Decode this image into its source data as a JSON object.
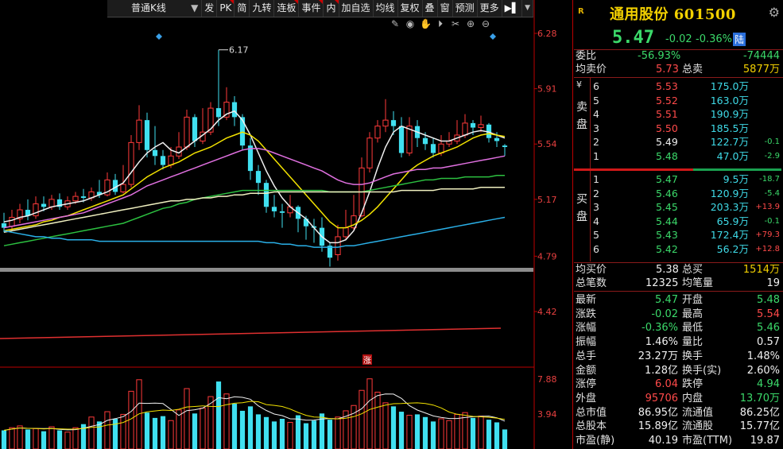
{
  "toolbar": {
    "chart_type": "普通K线",
    "items": [
      "发",
      "PK",
      "简",
      "九转",
      "连板",
      "事件",
      "内",
      "加自选",
      "均线",
      "复权",
      "叠",
      "窗",
      "预测",
      "更多"
    ]
  },
  "price_axis": [
    "6.28",
    "5.91",
    "5.54",
    "5.17",
    "4.79",
    "4.42"
  ],
  "volume_axis": [
    "7.88",
    "3.94"
  ],
  "high_marker": "6.17",
  "limit_marker": "涨",
  "chart_data": {
    "type": "candlestick",
    "title": "",
    "ylim": [
      4.42,
      6.28
    ],
    "candles": [
      {
        "o": 5.01,
        "c": 4.98,
        "h": 5.08,
        "l": 4.95
      },
      {
        "o": 4.99,
        "c": 5.05,
        "h": 5.1,
        "l": 4.96
      },
      {
        "o": 5.04,
        "c": 5.1,
        "h": 5.14,
        "l": 5.01
      },
      {
        "o": 5.1,
        "c": 5.06,
        "h": 5.17,
        "l": 5.03
      },
      {
        "o": 5.06,
        "c": 5.14,
        "h": 5.19,
        "l": 5.04
      },
      {
        "o": 5.14,
        "c": 5.12,
        "h": 5.19,
        "l": 5.09
      },
      {
        "o": 5.12,
        "c": 5.17,
        "h": 5.2,
        "l": 5.1
      },
      {
        "o": 5.17,
        "c": 5.12,
        "h": 5.21,
        "l": 5.1
      },
      {
        "o": 5.12,
        "c": 5.16,
        "h": 5.19,
        "l": 5.1
      },
      {
        "o": 5.16,
        "c": 5.19,
        "h": 5.22,
        "l": 5.14
      },
      {
        "o": 5.19,
        "c": 5.18,
        "h": 5.24,
        "l": 5.15
      },
      {
        "o": 5.18,
        "c": 5.22,
        "h": 5.25,
        "l": 5.16
      },
      {
        "o": 5.22,
        "c": 5.2,
        "h": 5.3,
        "l": 5.18
      },
      {
        "o": 5.2,
        "c": 5.3,
        "h": 5.35,
        "l": 5.19
      },
      {
        "o": 5.3,
        "c": 5.22,
        "h": 5.34,
        "l": 5.2
      },
      {
        "o": 5.22,
        "c": 5.27,
        "h": 5.4,
        "l": 5.21
      },
      {
        "o": 5.27,
        "c": 5.55,
        "h": 5.6,
        "l": 5.25
      },
      {
        "o": 5.55,
        "c": 5.7,
        "h": 5.8,
        "l": 5.5
      },
      {
        "o": 5.7,
        "c": 5.5,
        "h": 5.75,
        "l": 5.45
      },
      {
        "o": 5.5,
        "c": 5.46,
        "h": 5.66,
        "l": 5.4
      },
      {
        "o": 5.46,
        "c": 5.4,
        "h": 5.5,
        "l": 5.37
      },
      {
        "o": 5.4,
        "c": 5.46,
        "h": 5.52,
        "l": 5.38
      },
      {
        "o": 5.46,
        "c": 5.52,
        "h": 5.62,
        "l": 5.44
      },
      {
        "o": 5.52,
        "c": 5.72,
        "h": 5.77,
        "l": 5.5
      },
      {
        "o": 5.72,
        "c": 5.56,
        "h": 5.74,
        "l": 5.52
      },
      {
        "o": 5.56,
        "c": 5.62,
        "h": 5.78,
        "l": 5.54
      },
      {
        "o": 5.62,
        "c": 5.78,
        "h": 5.82,
        "l": 5.6
      },
      {
        "o": 5.78,
        "c": 5.72,
        "h": 6.17,
        "l": 5.66
      },
      {
        "o": 5.72,
        "c": 5.82,
        "h": 5.92,
        "l": 5.7
      },
      {
        "o": 5.82,
        "c": 5.72,
        "h": 5.86,
        "l": 5.66
      },
      {
        "o": 5.72,
        "c": 5.53,
        "h": 5.74,
        "l": 5.5
      },
      {
        "o": 5.53,
        "c": 5.36,
        "h": 5.58,
        "l": 5.3
      },
      {
        "o": 5.36,
        "c": 5.28,
        "h": 5.4,
        "l": 5.2
      },
      {
        "o": 5.28,
        "c": 5.12,
        "h": 5.3,
        "l": 5.08
      },
      {
        "o": 5.12,
        "c": 5.09,
        "h": 5.2,
        "l": 5.05
      },
      {
        "o": 5.09,
        "c": 5.08,
        "h": 5.14,
        "l": 4.98
      },
      {
        "o": 5.08,
        "c": 5.12,
        "h": 5.2,
        "l": 5.05
      },
      {
        "o": 5.12,
        "c": 5.04,
        "h": 5.13,
        "l": 4.95
      },
      {
        "o": 5.04,
        "c": 4.99,
        "h": 5.06,
        "l": 4.9
      },
      {
        "o": 4.99,
        "c": 4.98,
        "h": 5.04,
        "l": 4.88
      },
      {
        "o": 4.98,
        "c": 4.86,
        "h": 5.05,
        "l": 4.82
      },
      {
        "o": 4.86,
        "c": 4.78,
        "h": 4.88,
        "l": 4.72
      },
      {
        "o": 4.8,
        "c": 4.92,
        "h": 5.0,
        "l": 4.76
      },
      {
        "o": 4.92,
        "c": 4.98,
        "h": 5.1,
        "l": 4.9
      },
      {
        "o": 4.98,
        "c": 5.06,
        "h": 5.2,
        "l": 4.96
      },
      {
        "o": 5.06,
        "c": 5.38,
        "h": 5.45,
        "l": 5.05
      },
      {
        "o": 5.38,
        "c": 5.58,
        "h": 5.62,
        "l": 5.35
      },
      {
        "o": 5.58,
        "c": 5.66,
        "h": 5.7,
        "l": 5.55
      },
      {
        "o": 5.66,
        "c": 5.7,
        "h": 5.84,
        "l": 5.62
      },
      {
        "o": 5.7,
        "c": 5.66,
        "h": 5.76,
        "l": 5.6
      },
      {
        "o": 5.66,
        "c": 5.48,
        "h": 5.72,
        "l": 5.45
      },
      {
        "o": 5.48,
        "c": 5.66,
        "h": 5.72,
        "l": 5.46
      },
      {
        "o": 5.66,
        "c": 5.58,
        "h": 5.7,
        "l": 5.52
      },
      {
        "o": 5.58,
        "c": 5.54,
        "h": 5.62,
        "l": 5.5
      },
      {
        "o": 5.54,
        "c": 5.48,
        "h": 5.58,
        "l": 5.45
      },
      {
        "o": 5.48,
        "c": 5.54,
        "h": 5.6,
        "l": 5.46
      },
      {
        "o": 5.54,
        "c": 5.56,
        "h": 5.62,
        "l": 5.52
      },
      {
        "o": 5.56,
        "c": 5.6,
        "h": 5.7,
        "l": 5.54
      },
      {
        "o": 5.6,
        "c": 5.68,
        "h": 5.74,
        "l": 5.58
      },
      {
        "o": 5.68,
        "c": 5.65,
        "h": 5.7,
        "l": 5.6
      },
      {
        "o": 5.65,
        "c": 5.67,
        "h": 5.73,
        "l": 5.62
      },
      {
        "o": 5.67,
        "c": 5.58,
        "h": 5.68,
        "l": 5.55
      },
      {
        "o": 5.58,
        "c": 5.56,
        "h": 5.62,
        "l": 5.52
      },
      {
        "o": 5.53,
        "c": 5.52,
        "h": 5.54,
        "l": 5.46
      }
    ],
    "volumes": [
      2.1,
      2.4,
      2.6,
      2.2,
      2.3,
      2.0,
      2.5,
      2.1,
      1.9,
      2.4,
      2.8,
      3.6,
      3.1,
      4.2,
      3.4,
      3.9,
      6.5,
      7.8,
      4.1,
      3.5,
      3.7,
      3.2,
      4.4,
      6.8,
      4.0,
      4.6,
      5.9,
      7.6,
      6.2,
      5.1,
      4.3,
      4.8,
      3.9,
      3.6,
      3.1,
      3.4,
      3.0,
      3.8,
      2.9,
      3.2,
      4.0,
      3.3,
      3.6,
      4.3,
      4.9,
      6.6,
      7.9,
      6.4,
      5.2,
      4.8,
      4.2,
      3.8,
      3.9,
      3.6,
      3.1,
      3.4,
      3.2,
      3.9,
      4.1,
      3.5,
      3.7,
      3.3,
      3.0,
      2.2
    ],
    "ma_lines": [
      {
        "color": "#f0f0f0",
        "values": [
          5.02,
          5.03,
          5.05,
          5.06,
          5.08,
          5.1,
          5.12,
          5.13,
          5.14,
          5.15,
          5.16,
          5.18,
          5.2,
          5.22,
          5.25,
          5.28,
          5.35,
          5.42,
          5.48,
          5.52,
          5.55,
          5.5,
          5.48,
          5.52,
          5.56,
          5.6,
          5.64,
          5.7,
          5.74,
          5.76,
          5.7,
          5.6,
          5.48,
          5.36,
          5.26,
          5.18,
          5.12,
          5.08,
          5.04,
          4.98,
          4.92,
          4.88,
          4.88,
          4.9,
          4.96,
          5.08,
          5.22,
          5.38,
          5.52,
          5.62,
          5.66,
          5.64,
          5.62,
          5.6,
          5.58,
          5.56,
          5.56,
          5.58,
          5.6,
          5.62,
          5.63,
          5.62,
          5.6,
          5.58
        ]
      },
      {
        "color": "#f2e200",
        "values": [
          4.96,
          4.97,
          4.98,
          4.99,
          5.0,
          5.02,
          5.03,
          5.05,
          5.06,
          5.08,
          5.1,
          5.12,
          5.14,
          5.16,
          5.18,
          5.2,
          5.24,
          5.28,
          5.32,
          5.35,
          5.38,
          5.4,
          5.42,
          5.45,
          5.48,
          5.5,
          5.52,
          5.55,
          5.58,
          5.6,
          5.62,
          5.6,
          5.56,
          5.5,
          5.44,
          5.38,
          5.32,
          5.26,
          5.2,
          5.14,
          5.08,
          5.02,
          4.98,
          4.98,
          5.0,
          5.03,
          5.07,
          5.12,
          5.18,
          5.24,
          5.3,
          5.36,
          5.4,
          5.43,
          5.46,
          5.48,
          5.5,
          5.52,
          5.55,
          5.58,
          5.6,
          5.61,
          5.6,
          5.59
        ]
      },
      {
        "color": "#e070e0",
        "values": [
          4.98,
          4.99,
          5.0,
          5.01,
          5.02,
          5.03,
          5.04,
          5.05,
          5.06,
          5.07,
          5.08,
          5.1,
          5.12,
          5.14,
          5.16,
          5.18,
          5.2,
          5.23,
          5.26,
          5.28,
          5.3,
          5.32,
          5.34,
          5.36,
          5.38,
          5.4,
          5.42,
          5.44,
          5.46,
          5.48,
          5.5,
          5.51,
          5.51,
          5.5,
          5.48,
          5.46,
          5.44,
          5.42,
          5.4,
          5.38,
          5.36,
          5.33,
          5.3,
          5.28,
          5.27,
          5.27,
          5.28,
          5.3,
          5.32,
          5.34,
          5.35,
          5.36,
          5.37,
          5.37,
          5.38,
          5.38,
          5.39,
          5.4,
          5.41,
          5.42,
          5.43,
          5.44,
          5.45,
          5.46
        ]
      },
      {
        "color": "#2cc040",
        "values": [
          4.86,
          4.87,
          4.88,
          4.89,
          4.9,
          4.91,
          4.92,
          4.93,
          4.94,
          4.95,
          4.96,
          4.97,
          4.98,
          4.99,
          5.0,
          5.01,
          5.03,
          5.05,
          5.07,
          5.09,
          5.11,
          5.12,
          5.14,
          5.15,
          5.17,
          5.18,
          5.19,
          5.2,
          5.21,
          5.22,
          5.23,
          5.23,
          5.23,
          5.23,
          5.23,
          5.23,
          5.23,
          5.23,
          5.23,
          5.23,
          5.23,
          5.22,
          5.22,
          5.22,
          5.22,
          5.22,
          5.23,
          5.24,
          5.25,
          5.26,
          5.27,
          5.28,
          5.29,
          5.3,
          5.3,
          5.31,
          5.31,
          5.31,
          5.32,
          5.32,
          5.32,
          5.32,
          5.33,
          5.33
        ]
      },
      {
        "color": "#f0f0c0",
        "values": [
          4.95,
          4.96,
          4.97,
          4.98,
          4.99,
          5.0,
          5.01,
          5.02,
          5.03,
          5.04,
          5.05,
          5.06,
          5.07,
          5.08,
          5.09,
          5.1,
          5.11,
          5.12,
          5.13,
          5.14,
          5.15,
          5.16,
          5.16,
          5.17,
          5.17,
          5.18,
          5.18,
          5.19,
          5.19,
          5.2,
          5.2,
          5.21,
          5.21,
          5.21,
          5.22,
          5.22,
          5.22,
          5.22,
          5.22,
          5.22,
          5.22,
          5.22,
          5.22,
          5.22,
          5.22,
          5.22,
          5.22,
          5.22,
          5.22,
          5.22,
          5.23,
          5.23,
          5.23,
          5.23,
          5.23,
          5.24,
          5.24,
          5.24,
          5.24,
          5.24,
          5.25,
          5.25,
          5.25,
          5.25
        ]
      },
      {
        "color": "#2ab0e8",
        "values": [
          4.96,
          4.95,
          4.94,
          4.93,
          4.92,
          4.92,
          4.91,
          4.91,
          4.9,
          4.9,
          4.9,
          4.9,
          4.89,
          4.89,
          4.89,
          4.89,
          4.89,
          4.89,
          4.89,
          4.89,
          4.89,
          4.89,
          4.89,
          4.89,
          4.89,
          4.89,
          4.89,
          4.89,
          4.89,
          4.89,
          4.89,
          4.89,
          4.89,
          4.88,
          4.88,
          4.87,
          4.87,
          4.86,
          4.86,
          4.85,
          4.85,
          4.85,
          4.85,
          4.86,
          4.86,
          4.87,
          4.88,
          4.89,
          4.9,
          4.91,
          4.92,
          4.93,
          4.94,
          4.95,
          4.96,
          4.97,
          4.98,
          4.99,
          5.0,
          5.01,
          5.02,
          5.03,
          5.04,
          5.05
        ]
      }
    ]
  },
  "quote": {
    "logo": "R",
    "name": "通用股份 601500",
    "price": "5.47",
    "change": "-0.02",
    "change_pct": "-0.36%",
    "badge": "陆",
    "ratio_label": "委比",
    "ratio_value": "-56.93%",
    "ratio_diff": "-74444",
    "avg_sell_label": "均卖价",
    "avg_sell_value": "5.73",
    "total_sell_label": "总卖",
    "total_sell_value": "5877万",
    "sell_side_label": "卖盘",
    "buy_side_label": "买盘",
    "yen": "¥",
    "asks": [
      {
        "lvl": "6",
        "price": "5.53",
        "vol": "175.0万",
        "chg": ""
      },
      {
        "lvl": "5",
        "price": "5.52",
        "vol": "163.0万",
        "chg": ""
      },
      {
        "lvl": "4",
        "price": "5.51",
        "vol": "190.9万",
        "chg": ""
      },
      {
        "lvl": "3",
        "price": "5.50",
        "vol": "185.5万",
        "chg": ""
      },
      {
        "lvl": "2",
        "price": "5.49",
        "vol": "122.7万",
        "chg": "-0.1"
      },
      {
        "lvl": "1",
        "price": "5.48",
        "vol": "47.0万",
        "chg": "-2.9"
      }
    ],
    "bids": [
      {
        "lvl": "1",
        "price": "5.47",
        "vol": "9.5万",
        "chg": "-18.7"
      },
      {
        "lvl": "2",
        "price": "5.46",
        "vol": "120.9万",
        "chg": "-5.4"
      },
      {
        "lvl": "3",
        "price": "5.45",
        "vol": "203.3万",
        "chg": "+13.9"
      },
      {
        "lvl": "4",
        "price": "5.44",
        "vol": "65.9万",
        "chg": "-0.1"
      },
      {
        "lvl": "5",
        "price": "5.43",
        "vol": "172.4万",
        "chg": "+79.3"
      },
      {
        "lvl": "6",
        "price": "5.42",
        "vol": "56.2万",
        "chg": "+12.8"
      }
    ],
    "avg_buy_label": "均买价",
    "avg_buy_value": "5.38",
    "total_buy_label": "总买",
    "total_buy_value": "1514万",
    "total_trades_label": "总笔数",
    "total_trades_value": "12325",
    "avg_trade_label": "均笔量",
    "avg_trade_value": "19",
    "stats": [
      {
        "l1": "最新",
        "v1": "5.47",
        "c1": "grn",
        "l2": "开盘",
        "v2": "5.48",
        "c2": "grn"
      },
      {
        "l1": "涨跌",
        "v1": "-0.02",
        "c1": "grn",
        "l2": "最高",
        "v2": "5.54",
        "c2": "red"
      },
      {
        "l1": "涨幅",
        "v1": "-0.36%",
        "c1": "grn",
        "l2": "最低",
        "v2": "5.46",
        "c2": "grn"
      },
      {
        "l1": "振幅",
        "v1": "1.46%",
        "c1": "wht",
        "l2": "量比",
        "v2": "0.57",
        "c2": "wht"
      },
      {
        "l1": "总手",
        "v1": "23.27万",
        "c1": "wht",
        "l2": "换手",
        "v2": "1.48%",
        "c2": "wht"
      },
      {
        "l1": "金额",
        "v1": "1.28亿",
        "c1": "wht",
        "l2": "换手(实)",
        "v2": "2.60%",
        "c2": "wht"
      },
      {
        "l1": "涨停",
        "v1": "6.04",
        "c1": "red",
        "l2": "跌停",
        "v2": "4.94",
        "c2": "grn"
      },
      {
        "l1": "外盘",
        "v1": "95706",
        "c1": "red",
        "l2": "内盘",
        "v2": "13.70万",
        "c2": "grn"
      },
      {
        "l1": "总市值",
        "v1": "86.95亿",
        "c1": "wht",
        "l2": "流通值",
        "v2": "86.25亿",
        "c2": "wht"
      },
      {
        "l1": "总股本",
        "v1": "15.89亿",
        "c1": "wht",
        "l2": "流通股",
        "v2": "15.77亿",
        "c2": "wht"
      },
      {
        "l1": "市盈(静)",
        "v1": "40.19",
        "c1": "wht",
        "l2": "市盈(TTM)",
        "v2": "19.87",
        "c2": "wht"
      }
    ]
  }
}
